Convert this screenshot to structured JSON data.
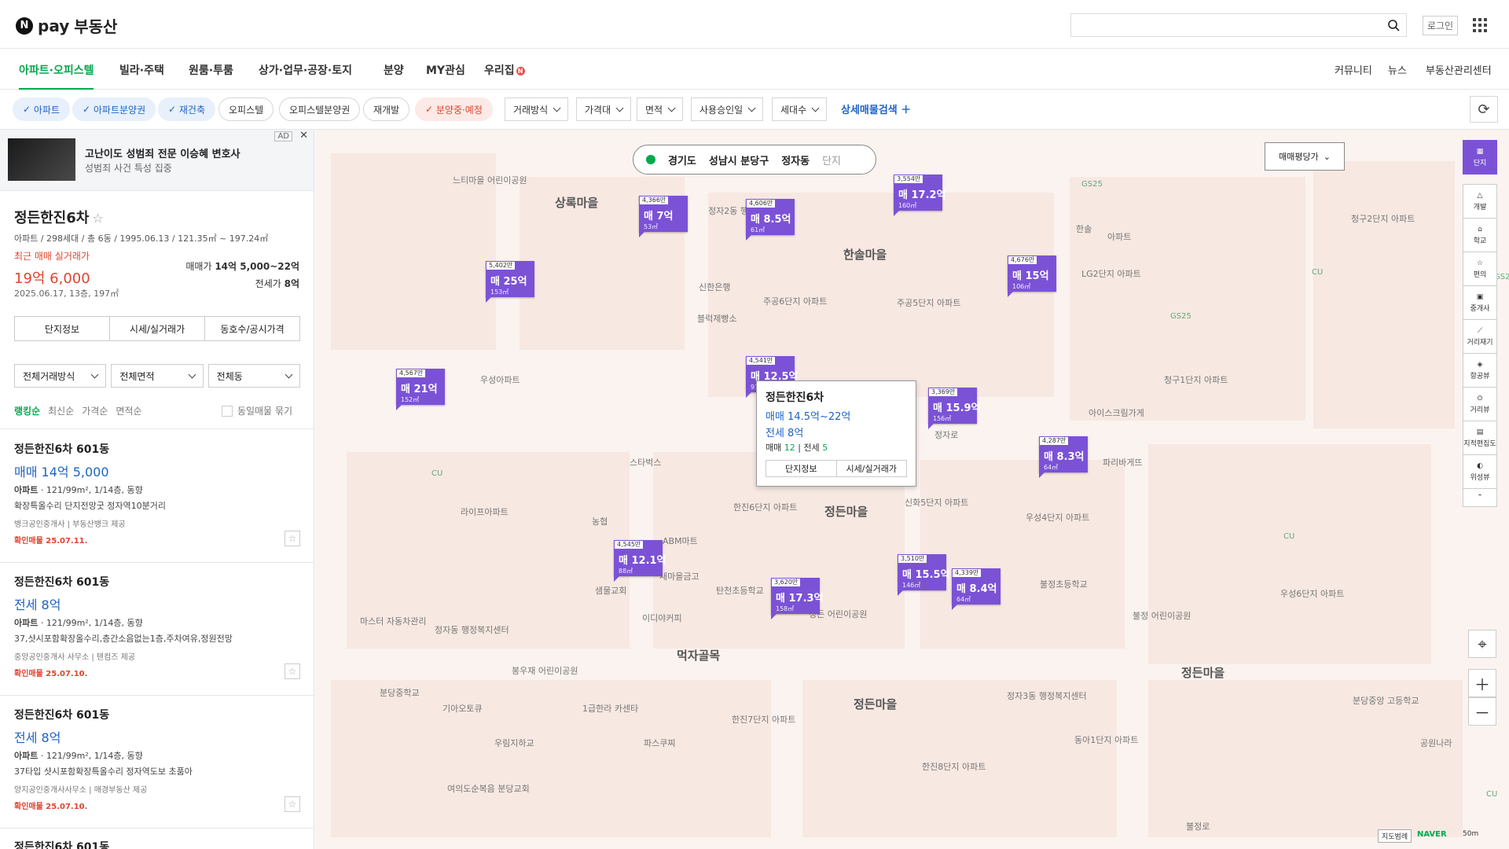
{
  "header": {
    "logo_n": "N",
    "logo_pay": "pay",
    "logo_text": "부동산",
    "login": "로그인"
  },
  "nav": {
    "items": [
      "아파트·오피스텔",
      "빌라·주택",
      "원룸·투룸",
      "상가·업무·공장·토지",
      "분양",
      "MY관심",
      "우리집"
    ],
    "badge": "N",
    "right": [
      "커뮤니티",
      "뉴스",
      "부동산관리센터"
    ]
  },
  "filters": {
    "chips": [
      "아파트",
      "아파트분양권",
      "재건축",
      "오피스텔",
      "오피스텔분양권",
      "재개발",
      "분양중·예정"
    ],
    "dropdowns": [
      "거래방식",
      "가격대",
      "면적",
      "사용승인일",
      "세대수"
    ],
    "detail": "상세매물검색"
  },
  "ad": {
    "tag": "AD",
    "title": "고난이도 성범죄 전문 이승혜 변호사",
    "sub": "성범죄 사건 특성 집중"
  },
  "complex": {
    "name": "정든한진6차",
    "meta": "아파트 / 298세대 / 총 6동 / 1995.06.13 / 121.35㎡ ~ 197.24㎡",
    "recent_label": "최근 매매 실거래가",
    "recent_price": "19억 6,000",
    "recent_sub": "2025.06.17, 13층, 197㎡",
    "sale_label": "매매가",
    "sale_value": "14억 5,000~22억",
    "jeonse_label": "전세가",
    "jeonse_value": "8억",
    "buttons": [
      "단지정보",
      "시세/실거래가",
      "동호수/공시가격"
    ]
  },
  "selects": [
    "전체거래방식",
    "전체면적",
    "전체동"
  ],
  "sort": {
    "options": [
      "랭킹순",
      "최신순",
      "가격순",
      "면적순"
    ],
    "group": "동일매물 묶기"
  },
  "listings": [
    {
      "title": "정든한진6차 601동",
      "price": "매매 14억 5,000",
      "type": "아파트",
      "detail": "121/99m², 1/14층, 동향",
      "desc": "확장특올수리 단지전망굿 정자역10분거리",
      "agent": "뱅크공인중개사 | 부동산뱅크 제공",
      "confirm": "확인매물 25.07.11."
    },
    {
      "title": "정든한진6차 601동",
      "price": "전세 8억",
      "type": "아파트",
      "detail": "121/99m², 1/14층, 동향",
      "desc": "37,샷시포함확장올수리,층간소음없는1층,주차여유,정원전망",
      "agent": "중앙공인중개사 사무소 | 텐컴즈 제공",
      "confirm": "확인매물 25.07.10."
    },
    {
      "title": "정든한진6차 601동",
      "price": "전세 8억",
      "type": "아파트",
      "detail": "121/99m², 1/14층, 동향",
      "desc": "37타입 샷시포함확장특올수리 정자역도보 초품아",
      "agent": "양지공인중개사사무소 | 매경부동산 제공",
      "confirm": "확인매물 25.07.10."
    },
    {
      "title": "정든한진6차 601동"
    }
  ],
  "map": {
    "breadcrumb": [
      "경기도",
      "성남시 분당구",
      "정자동",
      "단지"
    ],
    "price_tool": "매매평당가",
    "right_tools": [
      "단지",
      "개발",
      "학교",
      "편의",
      "중개사",
      "거리재기",
      "항공뷰",
      "거리뷰",
      "지적편집도",
      "위성뷰"
    ],
    "popup": {
      "name": "정든한진6차",
      "sale": "매매 14.5억~22억",
      "jeonse": "전세 8억",
      "count_sale_label": "매매",
      "count_sale": "12",
      "count_jeonse_label": "전세",
      "count_jeonse": "5",
      "btn1": "단지정보",
      "btn2": "시세/실거래가"
    },
    "markers": [
      {
        "top": "5,402만",
        "price": "매 25억",
        "area": "153㎡"
      },
      {
        "top": "4,366만",
        "price": "매 7억",
        "area": "53㎡"
      },
      {
        "top": "4,606만",
        "price": "매 8.5억",
        "area": "61㎡"
      },
      {
        "top": "3,554만",
        "price": "매 17.2억",
        "area": "160㎡"
      },
      {
        "top": "4,676만",
        "price": "매 15억",
        "area": "106㎡"
      },
      {
        "top": "4,567만",
        "price": "매 21억",
        "area": "152㎡"
      },
      {
        "top": "4,541만",
        "price": "매 12.5억",
        "area": "91㎡"
      },
      {
        "top": "3,369만",
        "price": "매 15.9억",
        "area": "156㎡"
      },
      {
        "top": "4,287만",
        "price": "매 8.3억",
        "area": "64㎡"
      },
      {
        "top": "4,545만",
        "price": "매 12.1억",
        "area": "88㎡"
      },
      {
        "top": "3,620만",
        "price": "매 17.3억",
        "area": "158㎡"
      },
      {
        "top": "3,510만",
        "price": "매 15.5억",
        "area": "146㎡"
      },
      {
        "top": "4,339만",
        "price": "매 8.4억",
        "area": "64㎡"
      }
    ],
    "labels": [
      "상록마을",
      "한솔마을",
      "정든마을",
      "먹자골목",
      "정든마을",
      "정든마을",
      "느티마을 어린이공원",
      "정자2동 행정복지센터",
      "신한은행",
      "블럭제빵소",
      "주공6단지 아파트",
      "주공5단지 아파트",
      "우성아파트",
      "LG2단지 아파트",
      "청구1단지 아파트",
      "아이스크림가게",
      "파리바게뜨",
      "스타벅스",
      "라이프아파트",
      "농협",
      "ABM마트",
      "새마을금고",
      "탄천초등학교",
      "샘물교회",
      "이디야커피",
      "정든 어린이공원",
      "마스터 자동차관리",
      "정자동 행정복지센터",
      "봉우재 어린이공원",
      "분당중학교",
      "기아오토큐",
      "1급한라 카센타",
      "우림지하교",
      "파스쿠찌",
      "신화5단지 아파트",
      "한진6단지 아파트",
      "한진7단지 아파트",
      "한진8단지 아파트",
      "우성4단지 아파트",
      "불정초등학교",
      "불정 어린이공원",
      "우성6단지 아파트",
      "정자3동 행정복지센터",
      "동아1단지 아파트",
      "분당중앙 고등학교",
      "공원나라",
      "여의도순복음 분당교회",
      "CU",
      "GS25",
      "CU",
      "GS25",
      "CU",
      "GS25",
      "CU",
      "불정로",
      "정자로",
      "청구2단지 아파트",
      "한솔",
      "아파트"
    ],
    "scale": "지도범례",
    "naver": "NAVER",
    "fifty": "50m"
  }
}
